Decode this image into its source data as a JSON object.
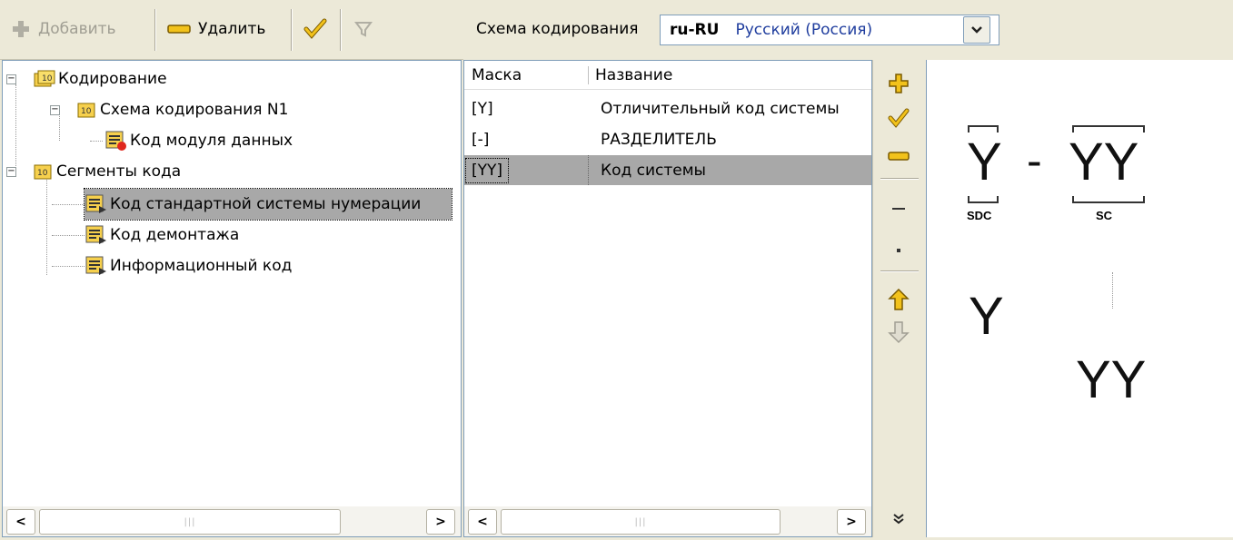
{
  "left_toolbar": {
    "add_label": "Добавить",
    "delete_label": "Удалить"
  },
  "tree": {
    "root_label": "Кодирование",
    "scheme_label": "Схема кодирования N1",
    "scheme_child_label": "Код модуля данных",
    "segments_label": "Сегменты кода",
    "segment_items": [
      "Код стандартной системы нумерации",
      "Код демонтажа",
      "Информационный код"
    ]
  },
  "header": {
    "scheme_label": "Схема кодирования",
    "locale_code": "ru-RU",
    "locale_name": "Русский (Россия)"
  },
  "grid": {
    "columns": [
      "Маска",
      "Название"
    ],
    "rows": [
      {
        "mask": "[Y]",
        "name": "Отличительный код системы"
      },
      {
        "mask": "[-]",
        "name": "РАЗДЕЛИТЕЛЬ"
      },
      {
        "mask": "[YY]",
        "name": "Код системы"
      }
    ],
    "selected_row": 2
  },
  "preview": {
    "part1": "Y",
    "separator": "-",
    "part2": "YY",
    "label1": "SDC",
    "label2": "SC",
    "detail1": "Y",
    "detail2": "YY"
  },
  "colors": {
    "background": "#ece9d8",
    "selection": "#a8a8a8",
    "border": "#7f9db9",
    "locale_name": "#1f3d9e"
  }
}
